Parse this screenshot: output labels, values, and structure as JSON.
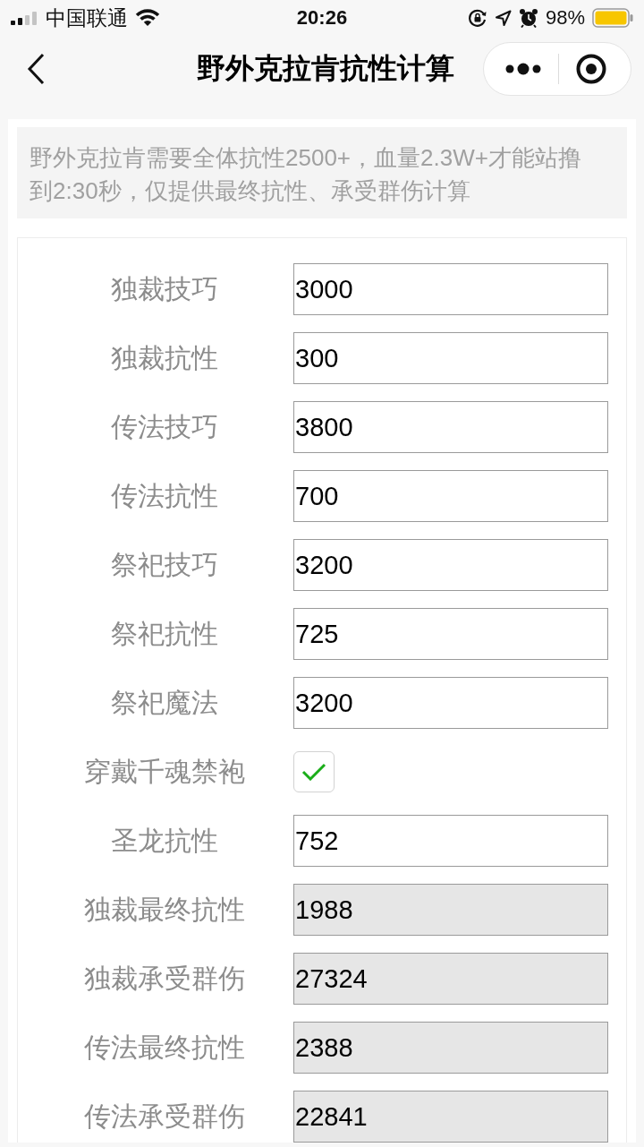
{
  "status_bar": {
    "carrier": "中国联通",
    "time": "20:26",
    "battery": "98%"
  },
  "nav": {
    "title": "野外克拉肯抗性计算"
  },
  "notice": "野外克拉肯需要全体抗性2500+，血量2.3W+才能站撸到2:30秒，仅提供最终抗性、承受群伤计算",
  "fields": [
    {
      "label": "独裁技巧",
      "kind": "input",
      "value": "3000"
    },
    {
      "label": "独裁抗性",
      "kind": "input",
      "value": "300"
    },
    {
      "label": "传法技巧",
      "kind": "input",
      "value": "3800"
    },
    {
      "label": "传法抗性",
      "kind": "input",
      "value": "700"
    },
    {
      "label": "祭祀技巧",
      "kind": "input",
      "value": "3200"
    },
    {
      "label": "祭祀抗性",
      "kind": "input",
      "value": "725"
    },
    {
      "label": "祭祀魔法",
      "kind": "input",
      "value": "3200"
    },
    {
      "label": "穿戴千魂禁袍",
      "kind": "checkbox",
      "checked": true
    },
    {
      "label": "圣龙抗性",
      "kind": "input",
      "value": "752"
    },
    {
      "label": "独裁最终抗性",
      "kind": "output",
      "value": "1988"
    },
    {
      "label": "独裁承受群伤",
      "kind": "output",
      "value": "27324"
    },
    {
      "label": "传法最终抗性",
      "kind": "output",
      "value": "2388"
    },
    {
      "label": "传法承受群伤",
      "kind": "output",
      "value": "22841"
    }
  ]
}
